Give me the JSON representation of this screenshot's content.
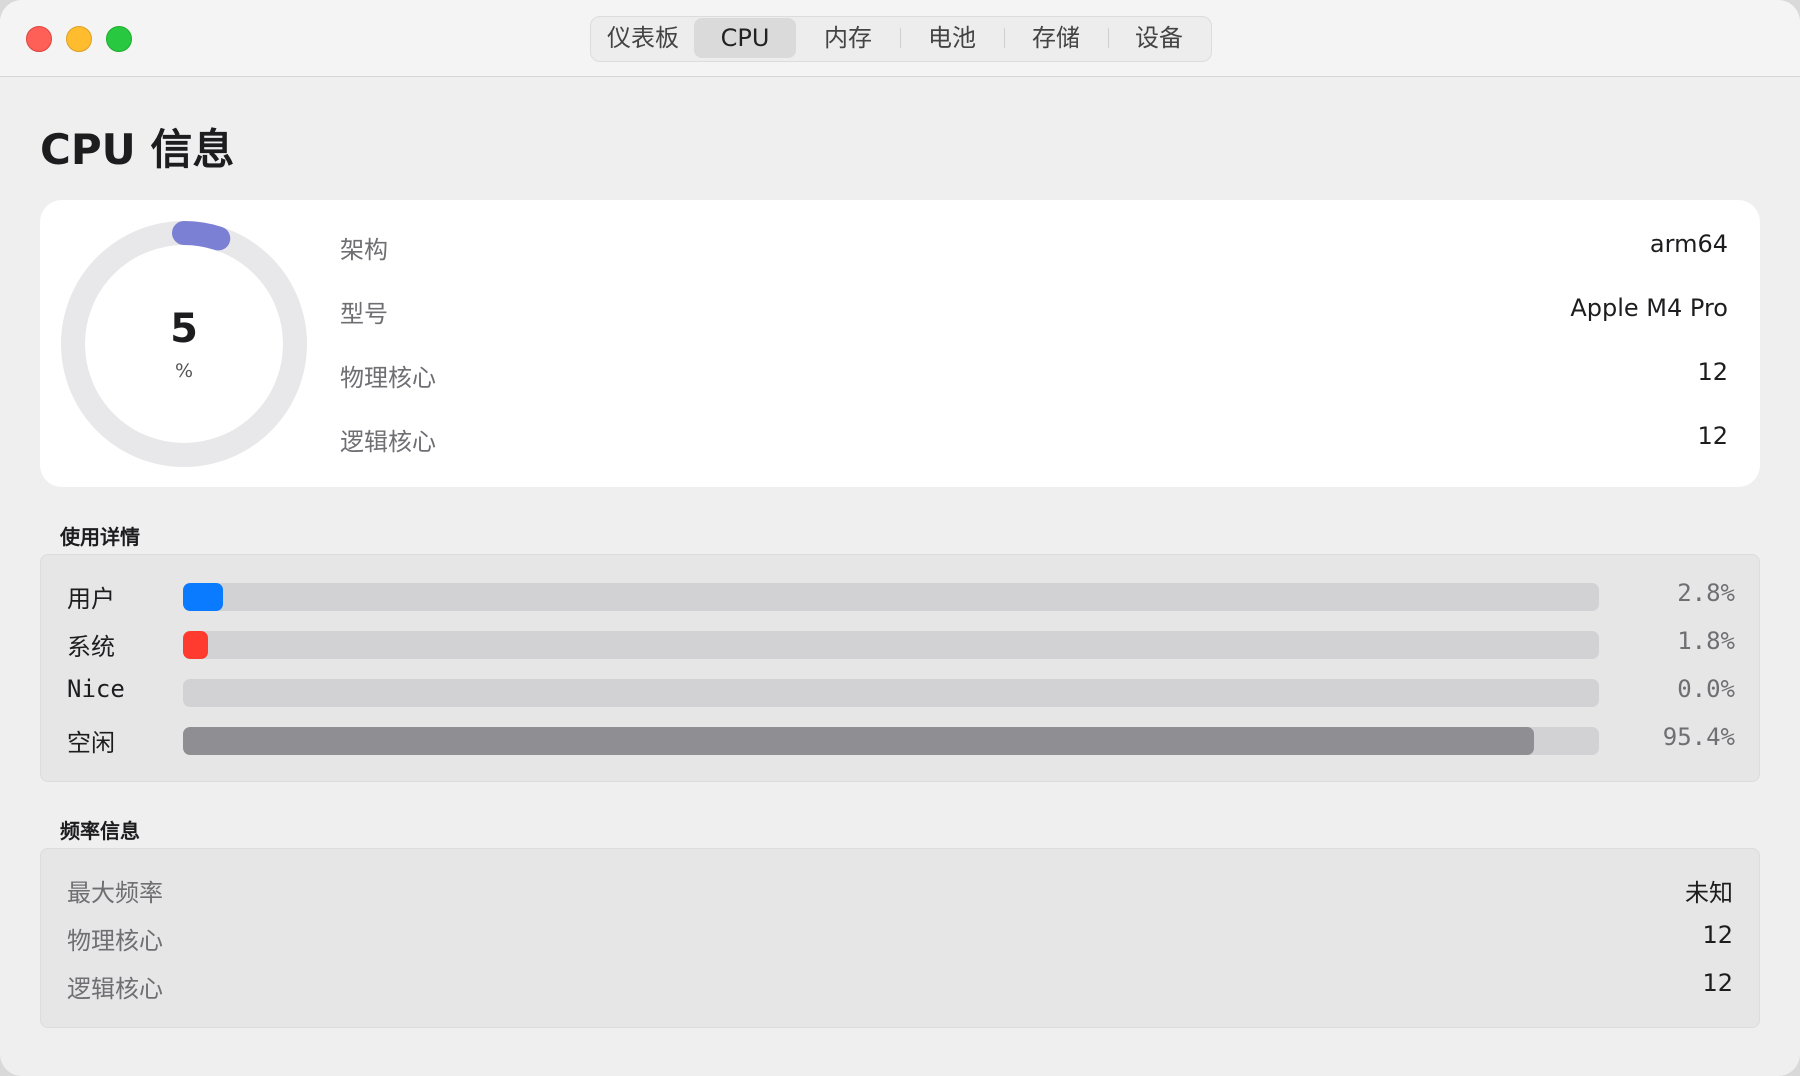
{
  "tabs": [
    {
      "label": "仪表板",
      "active": false
    },
    {
      "label": "CPU",
      "active": true
    },
    {
      "label": "内存",
      "active": false
    },
    {
      "label": "电池",
      "active": false
    },
    {
      "label": "存储",
      "active": false
    },
    {
      "label": "设备",
      "active": false
    }
  ],
  "page_title": "CPU 信息",
  "gauge": {
    "value": "5",
    "unit": "%",
    "fraction": 0.05,
    "track_color": "#e8e8ea",
    "fill_color": "#7b80d4"
  },
  "specs": [
    {
      "label": "架构",
      "value": "arm64"
    },
    {
      "label": "型号",
      "value": "Apple M4 Pro"
    },
    {
      "label": "物理核心",
      "value": "12"
    },
    {
      "label": "逻辑核心",
      "value": "12"
    }
  ],
  "usage_section": {
    "title": "使用详情",
    "rows": [
      {
        "label": "用户",
        "percent_text": "2.8%",
        "percent": 2.8,
        "color": "#0a7aff"
      },
      {
        "label": "系统",
        "percent_text": "1.8%",
        "percent": 1.8,
        "color": "#ff3b30"
      },
      {
        "label": "Nice",
        "percent_text": "0.0%",
        "percent": 0.0,
        "color": "#8e8e93"
      },
      {
        "label": "空闲",
        "percent_text": "95.4%",
        "percent": 95.4,
        "color": "#8e8e93"
      }
    ]
  },
  "freq_section": {
    "title": "频率信息",
    "rows": [
      {
        "label": "最大频率",
        "value": "未知"
      },
      {
        "label": "物理核心",
        "value": "12"
      },
      {
        "label": "逻辑核心",
        "value": "12"
      }
    ]
  }
}
